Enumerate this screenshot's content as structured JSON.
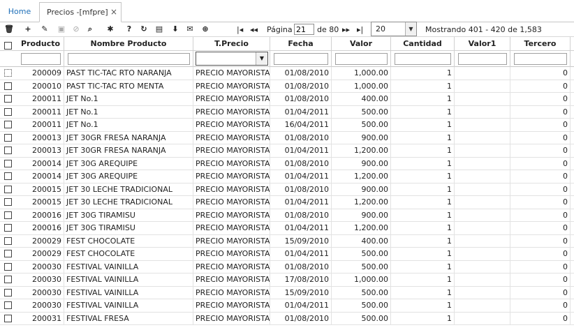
{
  "tabs": {
    "home_label": "Home",
    "active_label": "Precios -[mfpre]",
    "close_glyph": "×"
  },
  "toolbar": {
    "icons": [
      {
        "name": "delete-icon",
        "glyph": "🗑",
        "disabled": false
      },
      {
        "name": "add-icon",
        "glyph": "+",
        "disabled": false
      },
      {
        "name": "edit-icon",
        "glyph": "✎",
        "disabled": false
      },
      {
        "name": "save-icon",
        "glyph": "▣",
        "disabled": true
      },
      {
        "name": "cancel-icon",
        "glyph": "⊘",
        "disabled": true
      },
      {
        "name": "search-icon",
        "glyph": "⌕",
        "disabled": false
      },
      {
        "name": "gear-icon",
        "glyph": "✱",
        "disabled": false
      },
      {
        "name": "help-icon",
        "glyph": "?",
        "disabled": false
      },
      {
        "name": "refresh-icon",
        "glyph": "↻",
        "disabled": false
      },
      {
        "name": "comment-icon",
        "glyph": "▤",
        "disabled": false
      },
      {
        "name": "pin-icon",
        "glyph": "⬇",
        "disabled": false
      },
      {
        "name": "mail-icon",
        "glyph": "✉",
        "disabled": false
      },
      {
        "name": "add-circle-icon",
        "glyph": "⊕",
        "disabled": false
      }
    ],
    "first_glyph": "|◂",
    "prev_glyph": "◂◂",
    "next_glyph": "▸▸",
    "last_glyph": "▸|",
    "page_label": "Página",
    "page_value": "21",
    "page_total": "de 80",
    "page_size": "20",
    "showing": "Mostrando 401 - 420 de 1,583"
  },
  "columns": [
    "Producto",
    "Nombre Producto",
    "T.Precio",
    "Fecha",
    "Valor",
    "Cantidad",
    "Valor1",
    "Tercero"
  ],
  "rows": [
    {
      "producto": "200009",
      "nombre": "PAST TIC-TAC RTO NARANJA",
      "tprecio": "PRECIO MAYORISTA",
      "fecha": "01/08/2010",
      "valor": "1,000.00",
      "cantidad": "1",
      "valor1": "",
      "tercero": "0"
    },
    {
      "producto": "200010",
      "nombre": "PAST TIC-TAC RTO MENTA",
      "tprecio": "PRECIO MAYORISTA",
      "fecha": "01/08/2010",
      "valor": "1,000.00",
      "cantidad": "1",
      "valor1": "",
      "tercero": "0"
    },
    {
      "producto": "200011",
      "nombre": "JET No.1",
      "tprecio": "PRECIO MAYORISTA",
      "fecha": "01/08/2010",
      "valor": "400.00",
      "cantidad": "1",
      "valor1": "",
      "tercero": "0"
    },
    {
      "producto": "200011",
      "nombre": "JET No.1",
      "tprecio": "PRECIO MAYORISTA",
      "fecha": "01/04/2011",
      "valor": "500.00",
      "cantidad": "1",
      "valor1": "",
      "tercero": "0"
    },
    {
      "producto": "200011",
      "nombre": "JET No.1",
      "tprecio": "PRECIO MAYORISTA",
      "fecha": "16/04/2011",
      "valor": "500.00",
      "cantidad": "1",
      "valor1": "",
      "tercero": "0"
    },
    {
      "producto": "200013",
      "nombre": "JET 30GR FRESA NARANJA",
      "tprecio": "PRECIO MAYORISTA",
      "fecha": "01/08/2010",
      "valor": "900.00",
      "cantidad": "1",
      "valor1": "",
      "tercero": "0"
    },
    {
      "producto": "200013",
      "nombre": "JET 30GR FRESA NARANJA",
      "tprecio": "PRECIO MAYORISTA",
      "fecha": "01/04/2011",
      "valor": "1,200.00",
      "cantidad": "1",
      "valor1": "",
      "tercero": "0"
    },
    {
      "producto": "200014",
      "nombre": "JET 30G AREQUIPE",
      "tprecio": "PRECIO MAYORISTA",
      "fecha": "01/08/2010",
      "valor": "900.00",
      "cantidad": "1",
      "valor1": "",
      "tercero": "0"
    },
    {
      "producto": "200014",
      "nombre": "JET 30G AREQUIPE",
      "tprecio": "PRECIO MAYORISTA",
      "fecha": "01/04/2011",
      "valor": "1,200.00",
      "cantidad": "1",
      "valor1": "",
      "tercero": "0"
    },
    {
      "producto": "200015",
      "nombre": "JET 30 LECHE TRADICIONAL",
      "tprecio": "PRECIO MAYORISTA",
      "fecha": "01/08/2010",
      "valor": "900.00",
      "cantidad": "1",
      "valor1": "",
      "tercero": "0"
    },
    {
      "producto": "200015",
      "nombre": "JET 30 LECHE TRADICIONAL",
      "tprecio": "PRECIO MAYORISTA",
      "fecha": "01/04/2011",
      "valor": "1,200.00",
      "cantidad": "1",
      "valor1": "",
      "tercero": "0"
    },
    {
      "producto": "200016",
      "nombre": "JET 30G TIRAMISU",
      "tprecio": "PRECIO MAYORISTA",
      "fecha": "01/08/2010",
      "valor": "900.00",
      "cantidad": "1",
      "valor1": "",
      "tercero": "0"
    },
    {
      "producto": "200016",
      "nombre": "JET 30G TIRAMISU",
      "tprecio": "PRECIO MAYORISTA",
      "fecha": "01/04/2011",
      "valor": "1,200.00",
      "cantidad": "1",
      "valor1": "",
      "tercero": "0"
    },
    {
      "producto": "200029",
      "nombre": "FEST CHOCOLATE",
      "tprecio": "PRECIO MAYORISTA",
      "fecha": "15/09/2010",
      "valor": "400.00",
      "cantidad": "1",
      "valor1": "",
      "tercero": "0"
    },
    {
      "producto": "200029",
      "nombre": "FEST CHOCOLATE",
      "tprecio": "PRECIO MAYORISTA",
      "fecha": "01/04/2011",
      "valor": "500.00",
      "cantidad": "1",
      "valor1": "",
      "tercero": "0"
    },
    {
      "producto": "200030",
      "nombre": "FESTIVAL VAINILLA",
      "tprecio": "PRECIO MAYORISTA",
      "fecha": "01/08/2010",
      "valor": "500.00",
      "cantidad": "1",
      "valor1": "",
      "tercero": "0"
    },
    {
      "producto": "200030",
      "nombre": "FESTIVAL VAINILLA",
      "tprecio": "PRECIO MAYORISTA",
      "fecha": "17/08/2010",
      "valor": "1,000.00",
      "cantidad": "1",
      "valor1": "",
      "tercero": "0"
    },
    {
      "producto": "200030",
      "nombre": "FESTIVAL VAINILLA",
      "tprecio": "PRECIO MAYORISTA",
      "fecha": "15/09/2010",
      "valor": "500.00",
      "cantidad": "1",
      "valor1": "",
      "tercero": "0"
    },
    {
      "producto": "200030",
      "nombre": "FESTIVAL VAINILLA",
      "tprecio": "PRECIO MAYORISTA",
      "fecha": "01/04/2011",
      "valor": "500.00",
      "cantidad": "1",
      "valor1": "",
      "tercero": "0"
    },
    {
      "producto": "200031",
      "nombre": "FESTIVAL FRESA",
      "tprecio": "PRECIO MAYORISTA",
      "fecha": "01/08/2010",
      "valor": "500.00",
      "cantidad": "1",
      "valor1": "",
      "tercero": "0"
    }
  ]
}
